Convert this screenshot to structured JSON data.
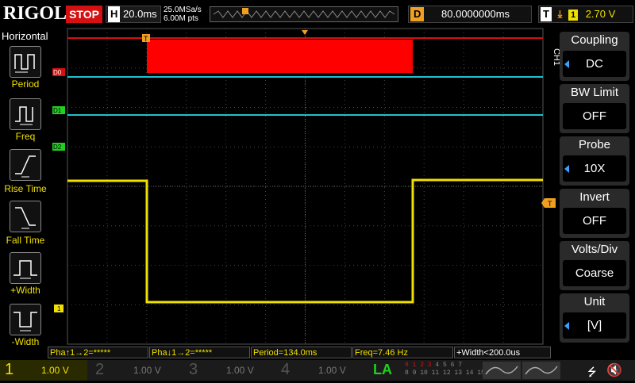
{
  "brand": "RIGOL",
  "run_state": "STOP",
  "timebase": {
    "label": "H",
    "value": "20.0ms"
  },
  "sampling": {
    "rate": "25.0MSa/s",
    "points": "6.00M pts"
  },
  "delay": {
    "label": "D",
    "value": "80.0000000ms"
  },
  "trigger": {
    "label": "T",
    "source": "1",
    "level": "2.70 V"
  },
  "left_panel": {
    "title": "Horizontal",
    "items": [
      {
        "label": "Period"
      },
      {
        "label": "Freq"
      },
      {
        "label": "Rise Time"
      },
      {
        "label": "Fall Time"
      },
      {
        "label": "+Width"
      },
      {
        "label": "-Width"
      }
    ]
  },
  "right_panel": {
    "channel_tab": "CH1",
    "items": [
      {
        "title": "Coupling",
        "value": "DC",
        "arrow": true
      },
      {
        "title": "BW Limit",
        "value": "OFF",
        "arrow": false
      },
      {
        "title": "Probe",
        "value": "10X",
        "arrow": true
      },
      {
        "title": "Invert",
        "value": "OFF",
        "arrow": false
      },
      {
        "title": "Volts/Div",
        "value": "Coarse",
        "arrow": false
      },
      {
        "title": "Unit",
        "value": "[V]",
        "arrow": true
      }
    ]
  },
  "digital_labels": [
    "D0",
    "D1",
    "D2"
  ],
  "ch1_marker": "1",
  "trigger_marker": "T",
  "measurements": [
    "Pha↑1→2=*****",
    "Pha↓1→2=*****",
    "Period=134.0ms",
    "Freq=7.46 Hz",
    "+Width<200.0us"
  ],
  "channels": [
    {
      "num": "1",
      "scale": "1.00 V"
    },
    {
      "num": "2",
      "scale": "1.00 V"
    },
    {
      "num": "3",
      "scale": "1.00 V"
    },
    {
      "num": "4",
      "scale": "1.00 V"
    }
  ],
  "la_label": "LA",
  "la_bits_top": "8 1 2 3",
  "la_bits_top2": "4 5 6 7",
  "la_bits_bot": "8 9 10 11",
  "la_bits_bot2": "12 13 14 15",
  "colors": {
    "ch1": "#f0e000",
    "digital": "#20c0d0",
    "trigger": "#f0a020",
    "stop": "#d41010",
    "la": "#20d020"
  }
}
